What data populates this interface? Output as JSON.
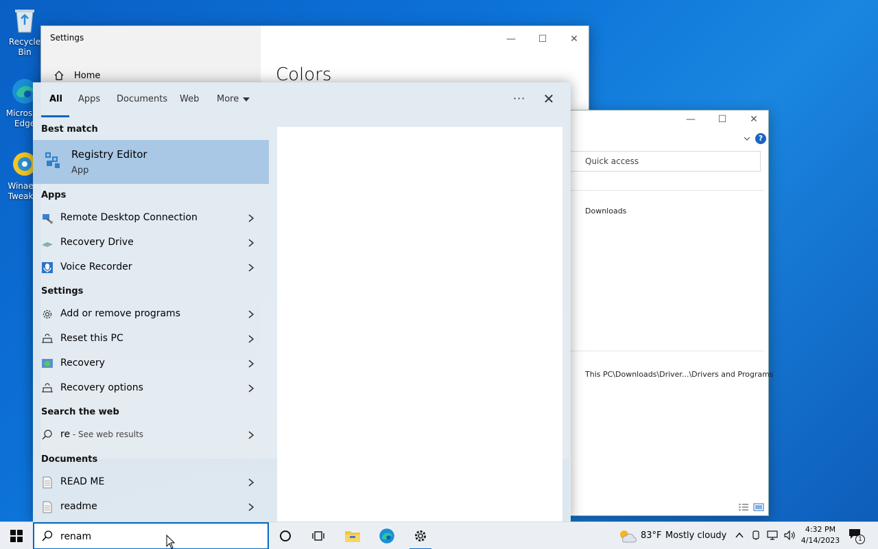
{
  "desktop": {
    "icons": [
      {
        "label": "Recycle Bin"
      },
      {
        "label": "Microsoft Edge"
      },
      {
        "label": "Winaero Tweaker"
      }
    ]
  },
  "settings": {
    "title": "Settings",
    "home": "Home",
    "heading": "Colors"
  },
  "explorer": {
    "address": "Quick access",
    "item": "Downloads",
    "path": "This PC\\Downloads\\Driver...\\Drivers and Programs"
  },
  "search": {
    "tabs": [
      "All",
      "Apps",
      "Documents",
      "Web",
      "More"
    ],
    "best_match_heading": "Best match",
    "best_match": {
      "name": "Registry Editor",
      "type": "App"
    },
    "apps_heading": "Apps",
    "apps": [
      {
        "label": "Remote Desktop Connection"
      },
      {
        "label": "Recovery Drive"
      },
      {
        "label": "Voice Recorder"
      }
    ],
    "settings_heading": "Settings",
    "settings_items": [
      {
        "label": "Add or remove programs"
      },
      {
        "label": "Reset this PC"
      },
      {
        "label": "Recovery"
      },
      {
        "label": "Recovery options"
      }
    ],
    "web_heading": "Search the web",
    "web": {
      "query": "re",
      "hint": " - See web results"
    },
    "docs_heading": "Documents",
    "documents": [
      {
        "label": "READ ME"
      },
      {
        "label": "readme"
      }
    ],
    "query": "renam"
  },
  "taskbar": {
    "weather_temp": "83°F",
    "weather_desc": "Mostly cloudy",
    "time": "4:32 PM",
    "date": "4/14/2023",
    "notifications": "1"
  },
  "colors": {
    "accent": "#0067c0",
    "selected": "#a9c8e6"
  }
}
